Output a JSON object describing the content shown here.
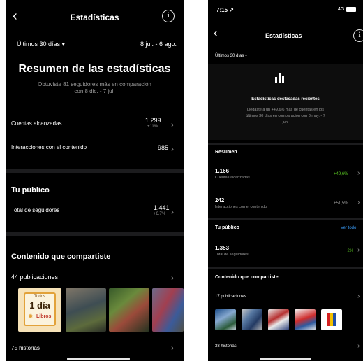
{
  "left": {
    "header": {
      "title": "Estadísticas"
    },
    "range": {
      "label": "Últimos 30 días ▾",
      "dates": "8 jul. - 6 ago."
    },
    "summary": {
      "title": "Resumen de las estadísticas",
      "subtitle_line1": "Obtuviste 81 seguidores más en comparación",
      "subtitle_line2": "con 8 dic. - 7 jul."
    },
    "metrics": [
      {
        "label": "Cuentas alcanzadas",
        "value": "1.299",
        "delta": "+11%"
      },
      {
        "label": "Interacciones con el contenido",
        "value": "985",
        "delta": ""
      }
    ],
    "audience": {
      "title": "Tu público",
      "label": "Total de seguidores",
      "value": "1.441",
      "delta": "+6,7%"
    },
    "content": {
      "title": "Contenido que compartiste",
      "posts": "44 publicaciones",
      "stories": "75 historias",
      "thumb1_line1": "Todos",
      "thumb1_line2": "1 día",
      "thumb1_line3": "Libros"
    }
  },
  "right": {
    "status": {
      "time": "7:15 ↗",
      "signal": "4G"
    },
    "header": {
      "title": "Estadísticas"
    },
    "range": {
      "label": "Últimos 30 días ▾"
    },
    "highlight": {
      "title": "Estadísticas destacadas recientes",
      "line1": "Llegaste a un +49,6% más de cuentas en los",
      "line2": "últimos 30 días en comparación con 8 may. - 7",
      "line3": "jun."
    },
    "resumen": {
      "title": "Resumen",
      "rows": [
        {
          "value": "1.166",
          "label": "Cuentas alcanzadas",
          "delta": "+49,6%"
        },
        {
          "value": "242",
          "label": "Interacciones con el contenido",
          "delta": "+51,5%"
        }
      ]
    },
    "audience": {
      "title": "Tu público",
      "link": "Ver todo",
      "value": "1.353",
      "label": "Total de seguidores",
      "delta": "+2%"
    },
    "content": {
      "title": "Contenido que compartiste",
      "posts": "17 publicaciones",
      "stories": "38 historias"
    }
  },
  "colors": {
    "background": "#000000",
    "accent_blue": "#3897f0",
    "positive_green": "#58c322",
    "divider": "#1c1c1e"
  }
}
